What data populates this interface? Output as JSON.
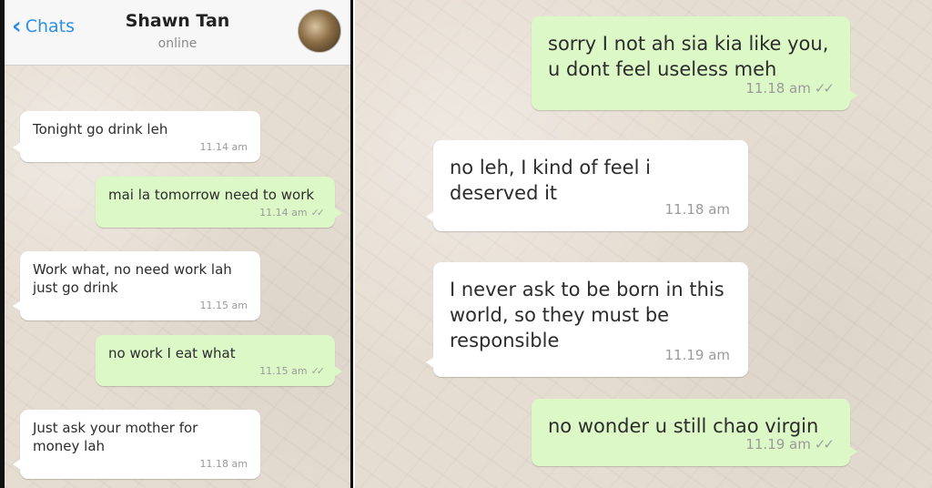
{
  "header": {
    "back_label": "Chats",
    "contact_name": "Shawn Tan",
    "status": "online"
  },
  "left_messages": [
    {
      "text": "Tonight go drink leh",
      "time": "11.14 am",
      "dir": "in"
    },
    {
      "text": "mai la tomorrow need to work",
      "time": "11.14 am",
      "dir": "out"
    },
    {
      "text": "Work what, no need work lah just go drink",
      "time": "11.15 am",
      "dir": "in"
    },
    {
      "text": "no work I eat what",
      "time": "11.15 am",
      "dir": "out"
    },
    {
      "text": "Just ask your mother for money lah",
      "time": "11.18 am",
      "dir": "in"
    }
  ],
  "right_messages": [
    {
      "text": "sorry I not ah sia kia like you, u dont feel useless meh",
      "time": "11.18 am",
      "dir": "out"
    },
    {
      "text": "no leh, I kind of feel i deserved it",
      "time": "11.18 am",
      "dir": "in"
    },
    {
      "text": "I never ask to be born in this world, so they must be responsible",
      "time": "11.19 am",
      "dir": "in"
    },
    {
      "text": "no wonder u still chao virgin",
      "time": "11.19 am",
      "dir": "out"
    }
  ],
  "colors": {
    "incoming_bubble": "#ffffff",
    "outgoing_bubble": "#dcf8c6",
    "accent": "#2f8fe8"
  },
  "icons": [
    "chevron-left-icon",
    "double-check-icon"
  ]
}
